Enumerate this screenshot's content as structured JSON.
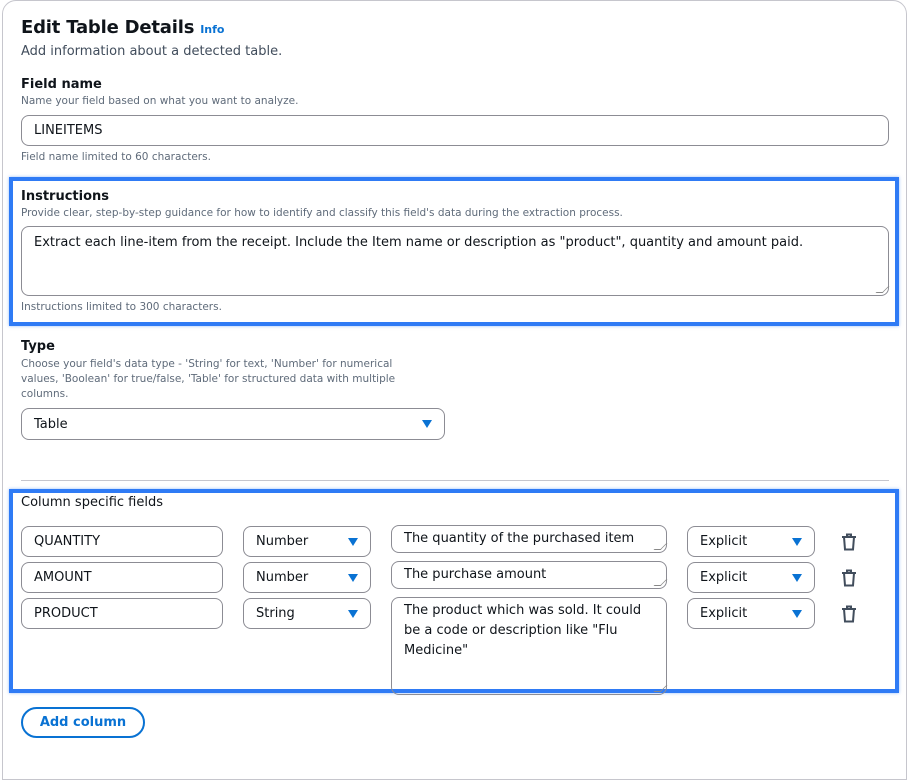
{
  "header": {
    "title": "Edit Table Details",
    "info": "Info",
    "subtitle": "Add information about a detected table."
  },
  "field_name": {
    "label": "Field name",
    "description": "Name your field based on what you want to analyze.",
    "value": "LINEITEMS",
    "constraint": "Field name limited to 60 characters."
  },
  "instructions": {
    "label": "Instructions",
    "description": "Provide clear, step-by-step guidance for how to identify and classify this field's data during the extraction process.",
    "value": "Extract each line-item from the receipt. Include the Item name or description as \"product\", quantity and amount paid.",
    "constraint": "Instructions limited to 300 characters."
  },
  "type": {
    "label": "Type",
    "description": "Choose your field's data type - 'String' for text, 'Number' for numerical values, 'Boolean' for true/false, 'Table' for structured data with multiple columns.",
    "value": "Table"
  },
  "columns": {
    "label": "Column specific fields",
    "rows": [
      {
        "name": "QUANTITY",
        "type": "Number",
        "description": "The quantity of the purchased item",
        "method": "Explicit"
      },
      {
        "name": "AMOUNT",
        "type": "Number",
        "description": "The purchase amount",
        "method": "Explicit"
      },
      {
        "name": "PRODUCT",
        "type": "String",
        "description": "The product which was sold. It could be a code or description like \"Flu Medicine\"",
        "method": "Explicit"
      }
    ]
  },
  "add_column": "Add column",
  "colors": {
    "accent": "#0972d3",
    "highlight": "#2f7bf5"
  }
}
